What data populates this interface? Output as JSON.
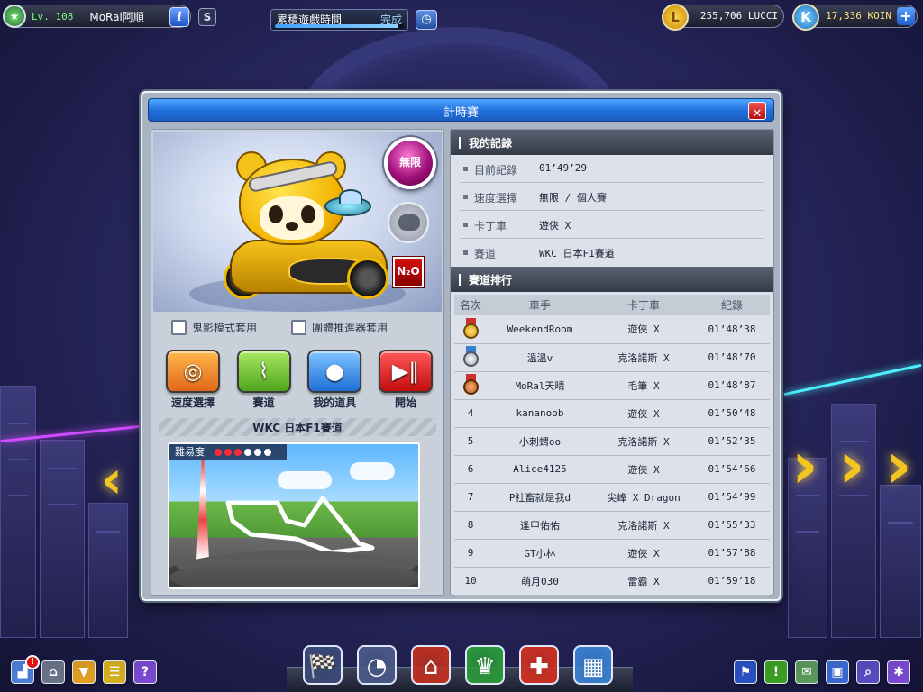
{
  "hud": {
    "level": "Lv. 108",
    "player_name": "MoRal阿順",
    "info_icon": "info-icon",
    "s_label": "S",
    "play_time_label": "累積遊戲時間",
    "play_time_status": "完成",
    "play_time_progress": 0.95,
    "lucci": "255,706 LUCCI",
    "lucci_icon_letter": "L",
    "koin": "17,336 KOIN",
    "koin_icon_letter": "K",
    "add_label": "+"
  },
  "dialog": {
    "title": "計時賽",
    "close_label": "✕",
    "speed_orb": "無限",
    "n2o_label": "N₂O",
    "ghost_mode": "鬼影模式套用",
    "team_booster": "團體推進器套用",
    "actions": [
      {
        "label": "速度選擇",
        "icon": "◎"
      },
      {
        "label": "賽道",
        "icon": "⌇"
      },
      {
        "label": "我的道具",
        "icon": "●"
      },
      {
        "label": "開始",
        "icon": "▶‖"
      }
    ],
    "track_name": "WKC 日本F1賽道",
    "difficulty_label": "難易度",
    "difficulty_value": 3,
    "difficulty_max": 6
  },
  "my_record": {
    "title": "我的記錄",
    "rows": [
      {
        "label": "目前紀錄",
        "value": "01’49’29"
      },
      {
        "label": "速度選擇",
        "value": "無限 / 個人賽"
      },
      {
        "label": "卡丁車",
        "value": "遊俠 X"
      },
      {
        "label": "賽道",
        "value": "WKC 日本F1賽道"
      }
    ]
  },
  "ranking": {
    "title": "賽道排行",
    "headers": [
      "名次",
      "車手",
      "卡丁車",
      "紀錄"
    ],
    "rows": [
      {
        "rank": "1",
        "medal": "gold",
        "driver": "WeekendRoom",
        "kart": "遊俠 X",
        "time": "01’48’38"
      },
      {
        "rank": "2",
        "medal": "silver",
        "driver": "溫溫v",
        "kart": "克洛諾斯 X",
        "time": "01’48’70"
      },
      {
        "rank": "3",
        "medal": "bronze",
        "driver": "MoRal天晴",
        "kart": "毛筆 X",
        "time": "01’48’87"
      },
      {
        "rank": "4",
        "medal": "",
        "driver": "kananoob",
        "kart": "遊俠 X",
        "time": "01’50’48"
      },
      {
        "rank": "5",
        "medal": "",
        "driver": "小刺蝟oo",
        "kart": "克洛諾斯 X",
        "time": "01’52’35"
      },
      {
        "rank": "6",
        "medal": "",
        "driver": "Alice4125",
        "kart": "遊俠 X",
        "time": "01’54’66"
      },
      {
        "rank": "7",
        "medal": "",
        "driver": "P社畜就是我d",
        "kart": "尖峰 X Dragon",
        "time": "01’54’99"
      },
      {
        "rank": "8",
        "medal": "",
        "driver": "逢甲佑佑",
        "kart": "克洛諾斯 X",
        "time": "01’55’33"
      },
      {
        "rank": "9",
        "medal": "",
        "driver": "GT小林",
        "kart": "遊俠 X",
        "time": "01’57’88"
      },
      {
        "rank": "10",
        "medal": "",
        "driver": "萌月030",
        "kart": "雷霸 X",
        "time": "01’59’18"
      }
    ]
  },
  "bottom": {
    "alert_count": "!",
    "help_label": "?",
    "left_buttons": [
      {
        "name": "profile-button",
        "icon": "▟",
        "color": "#4b7fd6"
      },
      {
        "name": "home-button",
        "icon": "⌂",
        "color": "#6a7488"
      },
      {
        "name": "download-button",
        "icon": "▼",
        "color": "#e0a020"
      },
      {
        "name": "notes-button",
        "icon": "☰",
        "color": "#d8b020"
      },
      {
        "name": "help-button",
        "icon": "?",
        "color": "#7a4ad0"
      }
    ],
    "dock": [
      {
        "name": "kart-garage-icon",
        "icon": "🏁",
        "color": "#3a4a78"
      },
      {
        "name": "speedometer-icon",
        "icon": "◔",
        "color": "#4a5a88"
      },
      {
        "name": "garage-icon",
        "icon": "⌂",
        "color": "#c03020"
      },
      {
        "name": "shop-icon",
        "icon": "♛",
        "color": "#2a9a3a"
      },
      {
        "name": "toolbox-icon",
        "icon": "✚",
        "color": "#d03020"
      },
      {
        "name": "building-icon",
        "icon": "▦",
        "color": "#3a80d0"
      }
    ],
    "right_buttons": [
      {
        "name": "flag-button",
        "icon": "⚑",
        "color": "#2a50c0"
      },
      {
        "name": "alert-button",
        "icon": "!",
        "color": "#3aa020"
      },
      {
        "name": "chat-button",
        "icon": "✉",
        "color": "#5a9a5a"
      },
      {
        "name": "mailbox-button",
        "icon": "▣",
        "color": "#3a6ad0"
      },
      {
        "name": "search-button",
        "icon": "⌕",
        "color": "#5a4ac0"
      },
      {
        "name": "settings-button",
        "icon": "✱",
        "color": "#7a4ad0"
      }
    ]
  }
}
